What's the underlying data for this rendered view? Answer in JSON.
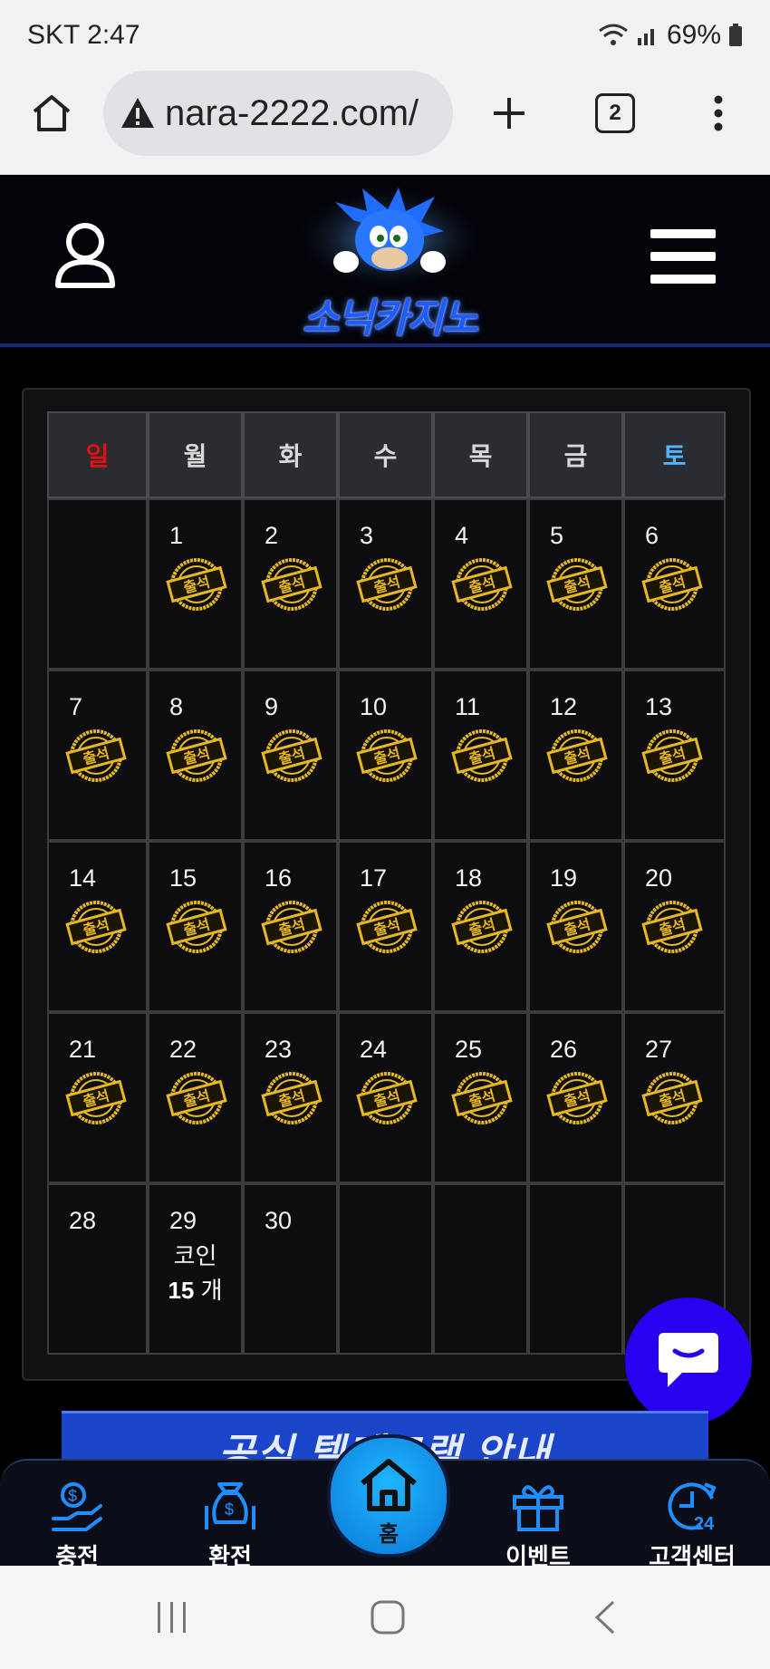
{
  "status_bar": {
    "carrier_time": "SKT 2:47",
    "battery": "69%",
    "icons": [
      "wifi-icon",
      "signal-icon",
      "battery-icon"
    ]
  },
  "browser": {
    "url": "nara-2222.com/",
    "tab_count": "2",
    "icons": [
      "home-icon",
      "warning-icon",
      "plus-icon",
      "tabs-icon",
      "more-icon"
    ]
  },
  "site": {
    "logo_text": "소닉카지노",
    "icons": [
      "user-icon",
      "menu-icon"
    ]
  },
  "calendar": {
    "weekdays": [
      "일",
      "월",
      "화",
      "수",
      "목",
      "금",
      "토"
    ],
    "days": [
      "1",
      "2",
      "3",
      "4",
      "5",
      "6",
      "7",
      "8",
      "9",
      "10",
      "11",
      "12",
      "13",
      "14",
      "15",
      "16",
      "17",
      "18",
      "19",
      "20",
      "21",
      "22",
      "23",
      "24",
      "25",
      "26",
      "27",
      "28",
      "29",
      "30"
    ],
    "stamp_text": "출석",
    "stamped_through_day": 27,
    "coin_label": "코인",
    "coin_amount": "15",
    "coin_unit": " 개",
    "colors": {
      "sunday": "#e01010",
      "saturday": "#4fb6ff",
      "stamp": "#e8b820"
    }
  },
  "banner": {
    "text": "공식 텔레그램 안내"
  },
  "bottom_nav": {
    "items": [
      {
        "label": "충전",
        "icon": "deposit-icon"
      },
      {
        "label": "환전",
        "icon": "withdraw-icon"
      },
      {
        "label": "홈",
        "icon": "home-icon"
      },
      {
        "label": "이벤트",
        "icon": "gift-icon"
      },
      {
        "label": "고객센터",
        "icon": "support-24-icon"
      }
    ]
  },
  "accent_color": "#1f8fff"
}
